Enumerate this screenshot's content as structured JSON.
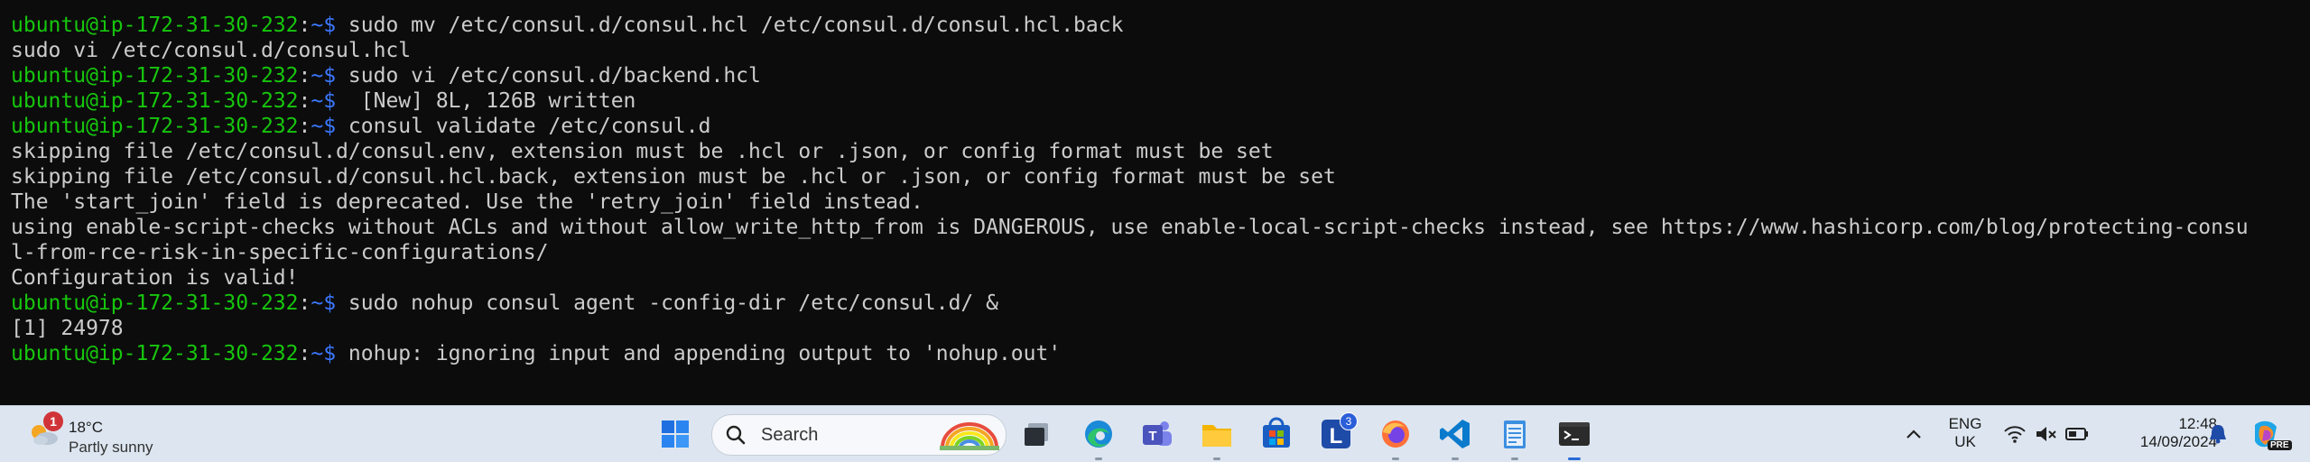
{
  "terminal": {
    "prompt_user": "ubuntu@ip-172-31-30-232",
    "prompt_sep": ":",
    "prompt_path": "~$",
    "lines": [
      {
        "type": "prompt",
        "text": " sudo mv /etc/consul.d/consul.hcl /etc/consul.d/consul.hcl.back"
      },
      {
        "type": "output",
        "text": "sudo vi /etc/consul.d/consul.hcl"
      },
      {
        "type": "prompt",
        "text": " sudo vi /etc/consul.d/backend.hcl"
      },
      {
        "type": "prompt",
        "text": "  [New] 8L, 126B written"
      },
      {
        "type": "prompt",
        "text": " consul validate /etc/consul.d"
      },
      {
        "type": "output",
        "text": "skipping file /etc/consul.d/consul.env, extension must be .hcl or .json, or config format must be set"
      },
      {
        "type": "output",
        "text": "skipping file /etc/consul.d/consul.hcl.back, extension must be .hcl or .json, or config format must be set"
      },
      {
        "type": "output",
        "text": "The 'start_join' field is deprecated. Use the 'retry_join' field instead."
      },
      {
        "type": "output",
        "text": "using enable-script-checks without ACLs and without allow_write_http_from is DANGEROUS, use enable-local-script-checks instead, see https://www.hashicorp.com/blog/protecting-consu"
      },
      {
        "type": "output",
        "text": "l-from-rce-risk-in-specific-configurations/"
      },
      {
        "type": "output",
        "text": "Configuration is valid!"
      },
      {
        "type": "prompt",
        "text": " sudo nohup consul agent -config-dir /etc/consul.d/ &"
      },
      {
        "type": "output",
        "text": "[1] 24978"
      },
      {
        "type": "prompt",
        "text": " nohup: ignoring input and appending output to 'nohup.out'"
      }
    ]
  },
  "taskbar": {
    "weather": {
      "badge": "1",
      "temp": "18°C",
      "desc": "Partly sunny"
    },
    "search": {
      "label": "Search"
    },
    "pinned": [
      {
        "name": "start-menu-icon"
      },
      {
        "name": "task-view-icon"
      },
      {
        "name": "edge-browser-icon"
      },
      {
        "name": "teams-icon"
      },
      {
        "name": "file-explorer-icon"
      },
      {
        "name": "microsoft-store-icon"
      },
      {
        "name": "lens-app-icon",
        "badge": "3"
      },
      {
        "name": "firefox-icon"
      },
      {
        "name": "vscode-icon"
      },
      {
        "name": "notepad-icon"
      },
      {
        "name": "terminal-icon"
      }
    ],
    "tray": {
      "lang_line1": "ENG",
      "lang_line2": "UK",
      "time": "12:48",
      "date": "14/09/2024",
      "copilot_badge": "PRE"
    }
  },
  "colors": {
    "prompt_user": "#16c60c",
    "prompt_path": "#3b78ff",
    "text": "#cccccc",
    "background": "#0c0c0c",
    "taskbar": "#dde6f0"
  }
}
